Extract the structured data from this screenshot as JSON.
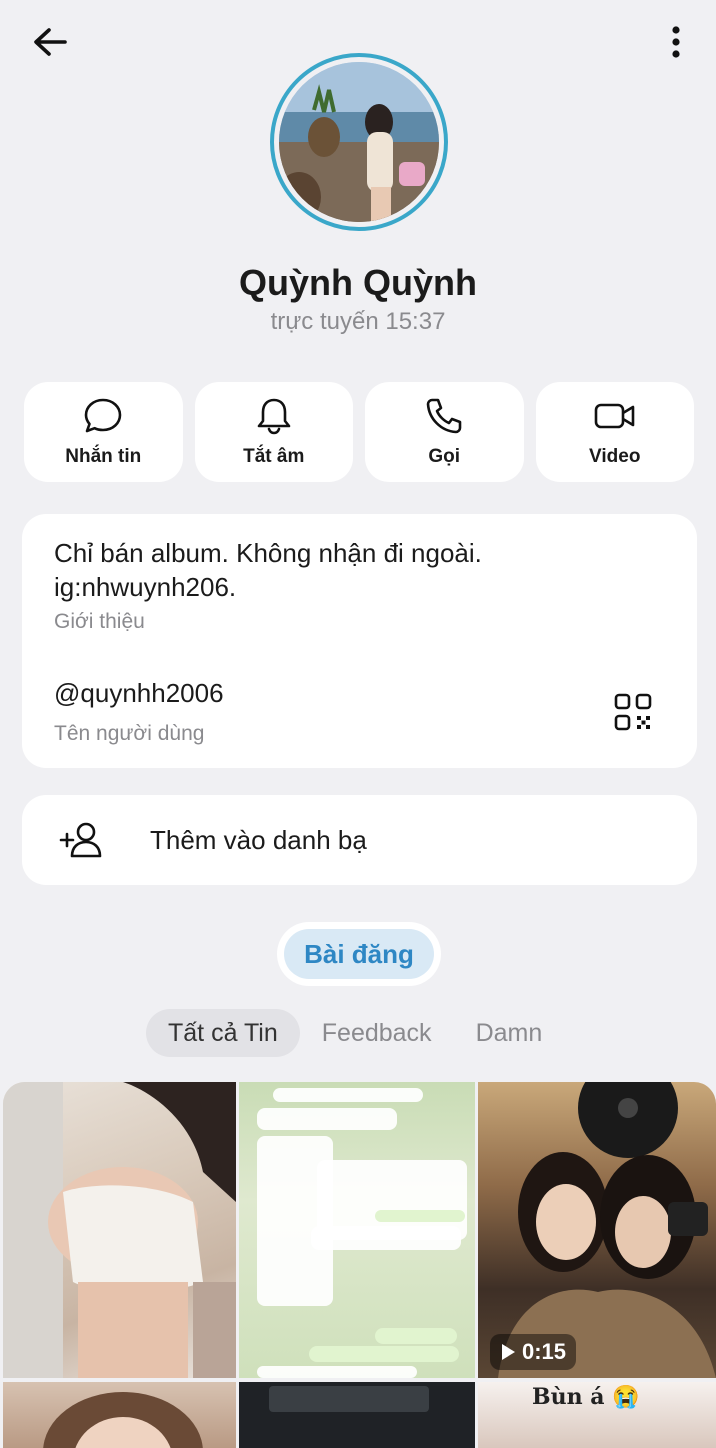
{
  "header": {
    "back_icon": "arrow-left-icon",
    "more_icon": "more-vertical-icon"
  },
  "profile": {
    "name": "Quỳnh Quỳnh",
    "status": "trực tuyến 15:37",
    "ring_color": "#3aa7c9"
  },
  "actions": [
    {
      "label": "Nhắn tin",
      "icon": "chat-bubble-icon"
    },
    {
      "label": "Tắt âm",
      "icon": "bell-icon"
    },
    {
      "label": "Gọi",
      "icon": "phone-icon"
    },
    {
      "label": "Video",
      "icon": "video-camera-icon"
    }
  ],
  "info": {
    "bio": "Chỉ bán album. Không nhận đi ngoài. ig:nhwuynh206.",
    "bio_label": "Giới thiệu",
    "username": "@quynhh2006",
    "username_label": "Tên người dùng",
    "qr_icon": "qr-code-icon"
  },
  "contact": {
    "label": "Thêm vào danh bạ",
    "icon": "add-user-icon"
  },
  "posts": {
    "pill_label": "Bài đăng",
    "accent": "#2e87c4",
    "tabs": [
      "Tất cả Tin",
      "Feedback",
      "Damn"
    ],
    "active_tab": 0
  },
  "grid": {
    "video_duration": "0:15",
    "caption_tile6": "Bùn á 😭"
  }
}
